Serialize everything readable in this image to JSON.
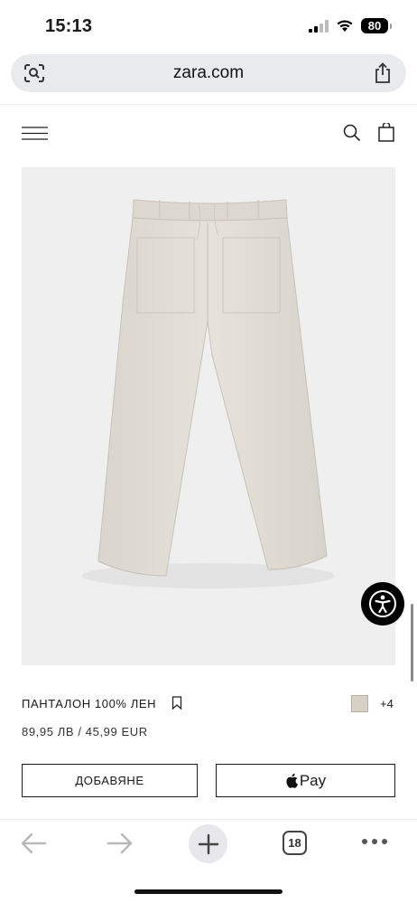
{
  "status_bar": {
    "time": "15:13",
    "battery": "80"
  },
  "browser": {
    "url": "zara.com",
    "tab_count": "18"
  },
  "site_header": {
    "icons": [
      "menu-icon",
      "search-icon",
      "bag-icon"
    ]
  },
  "product": {
    "name": "ПАНТАЛОН 100% ЛЕН",
    "price": "89,95 ЛВ / 45,99 EUR",
    "more_colors": "+4",
    "swatch_color": "#d6d1c4",
    "add_button": "ДОБАВЯНЕ",
    "apple_pay_label": "Pay"
  },
  "colors": {
    "image_background": "#efeff0",
    "text": "#1a1a1a"
  }
}
